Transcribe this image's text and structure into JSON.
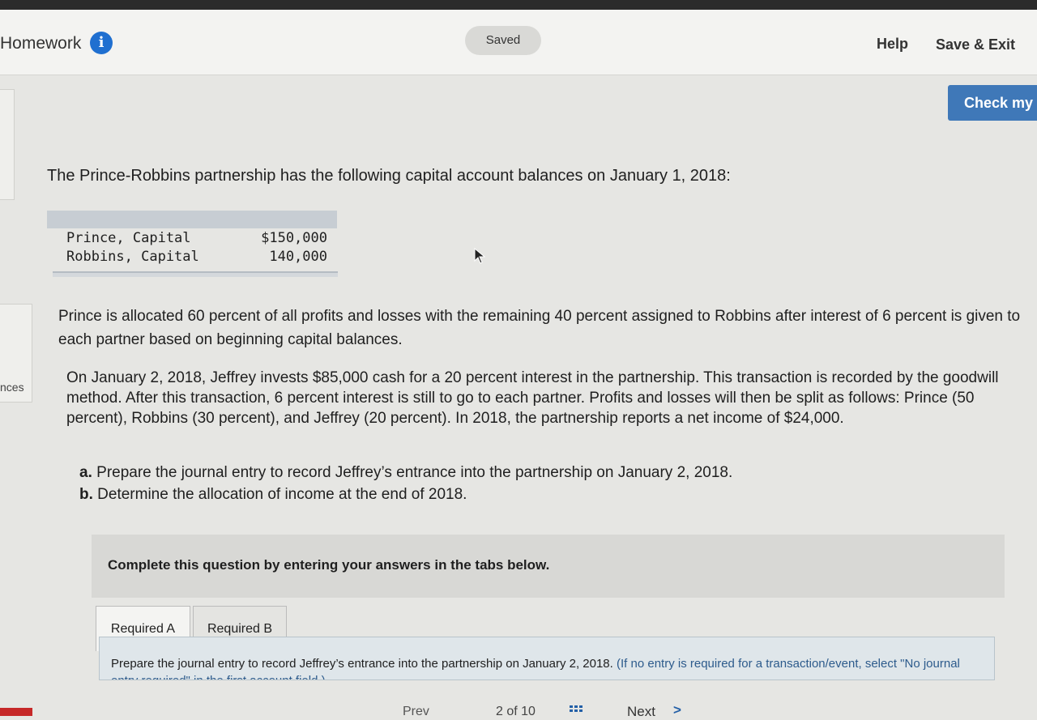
{
  "header": {
    "title": "Homework",
    "info_icon": "i",
    "saved_label": "Saved",
    "help_label": "Help",
    "save_exit_label": "Save & Exit",
    "check_label": "Check my w"
  },
  "sidebar": {
    "partial_label": "nces"
  },
  "question": {
    "intro": "The Prince-Robbins partnership has the following capital account balances on January 1, 2018:",
    "balances": [
      {
        "label": "Prince, Capital",
        "value": "$150,000"
      },
      {
        "label": "Robbins, Capital",
        "value": "140,000"
      }
    ],
    "para1": "Prince is allocated 60 percent of all profits and losses with the remaining 40 percent assigned to Robbins after interest of 6 percent is given to each partner based on beginning capital balances.",
    "para2": "On January 2, 2018, Jeffrey invests $85,000 cash for a 20 percent interest in the partnership. This transaction is recorded by the goodwill method. After this transaction, 6 percent interest is still to go to each partner. Profits and losses will then be split as follows: Prince (50 percent), Robbins (30 percent), and Jeffrey (20 percent). In 2018, the partnership reports a net income of $24,000.",
    "items": [
      {
        "marker": "a.",
        "text": "Prepare the journal entry to record Jeffrey’s entrance into the partnership on January 2, 2018."
      },
      {
        "marker": "b.",
        "text": "Determine the allocation of income at the end of 2018."
      }
    ]
  },
  "answer": {
    "complete_text": "Complete this question by entering your answers in the tabs below.",
    "tabs": [
      "Required A",
      "Required B"
    ],
    "req_text": "Prepare the journal entry to record Jeffrey’s entrance into the partnership on January 2, 2018.",
    "req_hint": "(If no entry is required for a transaction/event, select \"No journal entry required\" in the first account field.)"
  },
  "footer": {
    "prev_label": "Prev",
    "page_indicator": "2 of 10",
    "next_label": "Next",
    "next_chevron": ">"
  },
  "colors": {
    "accent": "#3f78b8",
    "info_icon": "#1f6fd0",
    "table_header": "#c7cdd3"
  }
}
